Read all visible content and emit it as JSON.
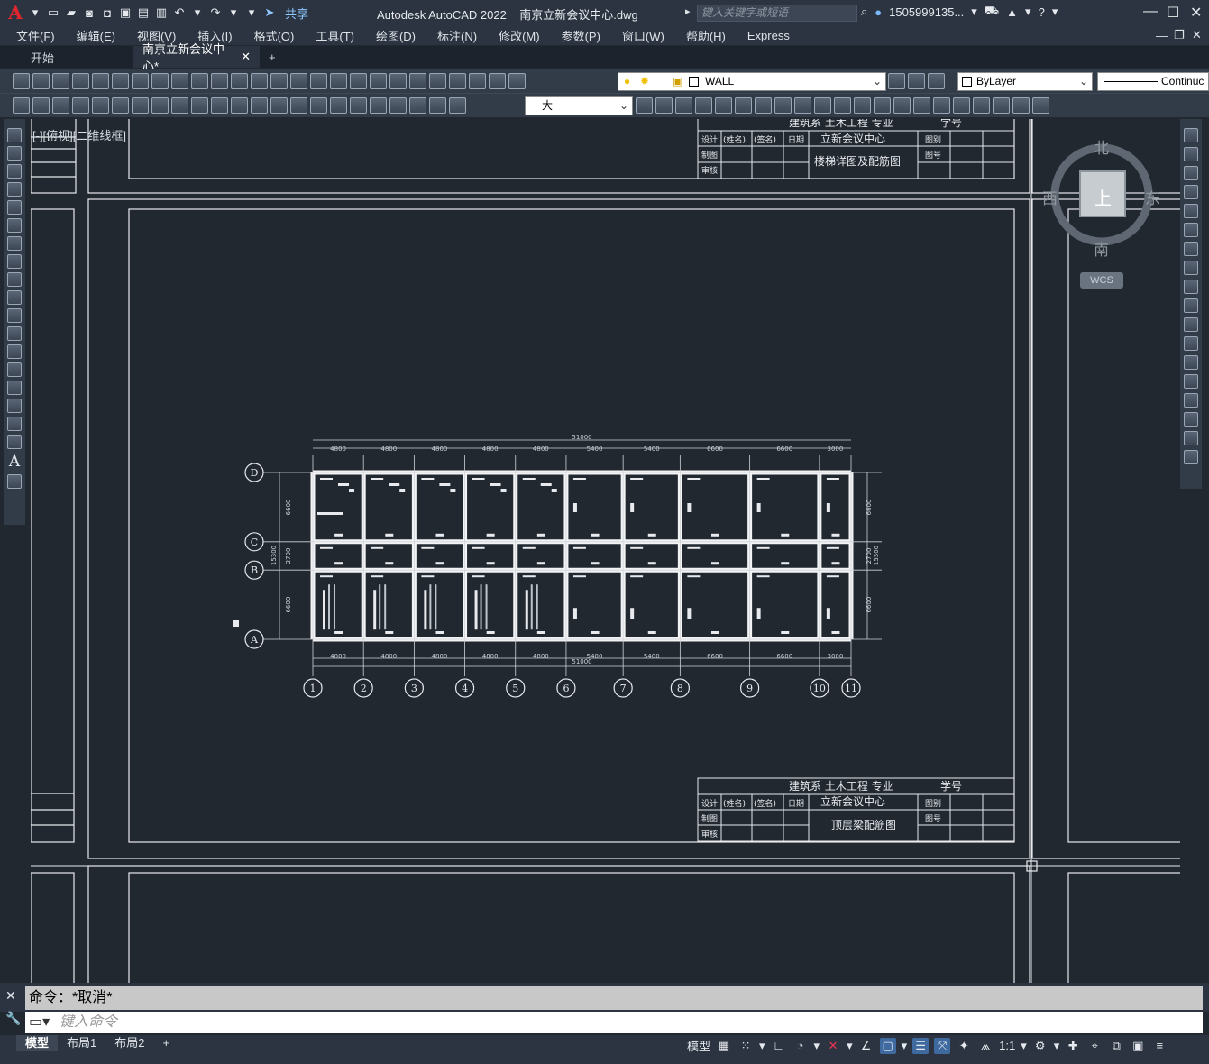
{
  "title": {
    "app": "Autodesk AutoCAD 2022",
    "file": "南京立新会议中心.dwg",
    "search_placeholder": "键入关键字或短语",
    "user": "1505999135...",
    "share": "共享"
  },
  "menu": [
    "文件(F)",
    "编辑(E)",
    "视图(V)",
    "插入(I)",
    "格式(O)",
    "工具(T)",
    "绘图(D)",
    "标注(N)",
    "修改(M)",
    "参数(P)",
    "窗口(W)",
    "帮助(H)",
    "Express"
  ],
  "tabs": {
    "start": "开始",
    "active": "南京立新会议中心*",
    "add": "+"
  },
  "toolbar": {
    "layer": "WALL",
    "color": "ByLayer",
    "linetype": "Continuc",
    "textstyle": "大"
  },
  "viewport_label": "[-][俯视][二维线框]",
  "viewcube": {
    "north": "北",
    "south": "南",
    "east": "东",
    "west": "西",
    "top": "上",
    "wcs": "WCS"
  },
  "drawing": {
    "top_title": {
      "school": "建筑系  土木工程  专业",
      "student_no": "学号",
      "design": "设计",
      "name": "(姓名)",
      "sign": "(签名)",
      "date": "日期",
      "project": "立新会议中心",
      "drawing_type": "图别",
      "draw": "制图",
      "drawing_no": "图号",
      "check": "审核",
      "sheet": "楼梯详图及配筋图"
    },
    "bottom_title": {
      "school": "建筑系  土木工程  专业",
      "student_no": "学号",
      "design": "设计",
      "name": "(姓名)",
      "sign": "(签名)",
      "date": "日期",
      "project": "立新会议中心",
      "drawing_type": "图别",
      "draw": "制图",
      "drawing_no": "图号",
      "check": "审核",
      "sheet": "顶层梁配筋图"
    },
    "total_dim": "51000",
    "bay_dims": [
      "4800",
      "4800",
      "4800",
      "4800",
      "4800",
      "5400",
      "5400",
      "6600",
      "6600",
      "3000"
    ],
    "col_axes": [
      "1",
      "2",
      "3",
      "4",
      "5",
      "6",
      "7",
      "8",
      "9",
      "10",
      "11"
    ],
    "row_axes": [
      "D",
      "C",
      "B",
      "A"
    ],
    "row_dims": [
      "6600",
      "2700",
      "6600"
    ],
    "row_total": "15300"
  },
  "command": {
    "history": "命令：*取消*",
    "placeholder": "键入命令"
  },
  "status": {
    "tabs": [
      "模型",
      "布局1",
      "布局2"
    ],
    "model": "模型",
    "scale": "1:1"
  }
}
